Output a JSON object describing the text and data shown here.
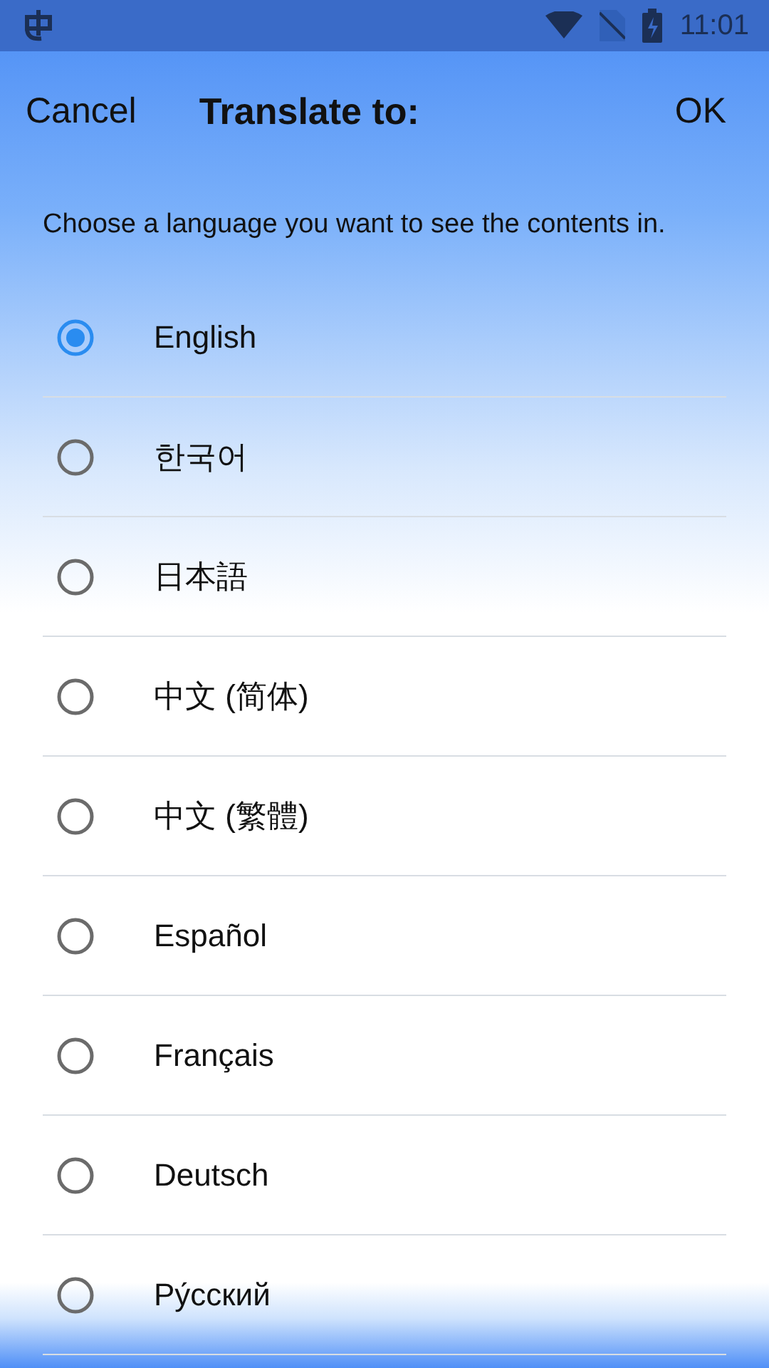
{
  "status_bar": {
    "time": "11:01"
  },
  "header": {
    "cancel": "Cancel",
    "title": "Translate to:",
    "ok": "OK"
  },
  "instruction": "Choose a language you want to see the contents in.",
  "languages": [
    {
      "label": "English",
      "selected": true
    },
    {
      "label": "한국어",
      "selected": false
    },
    {
      "label": "日本語",
      "selected": false
    },
    {
      "label": "中文 (简体)",
      "selected": false
    },
    {
      "label": "中文 (繁體)",
      "selected": false
    },
    {
      "label": "Español",
      "selected": false
    },
    {
      "label": "Français",
      "selected": false
    },
    {
      "label": "Deutsch",
      "selected": false
    },
    {
      "label": "Ру́сский",
      "selected": false
    }
  ]
}
